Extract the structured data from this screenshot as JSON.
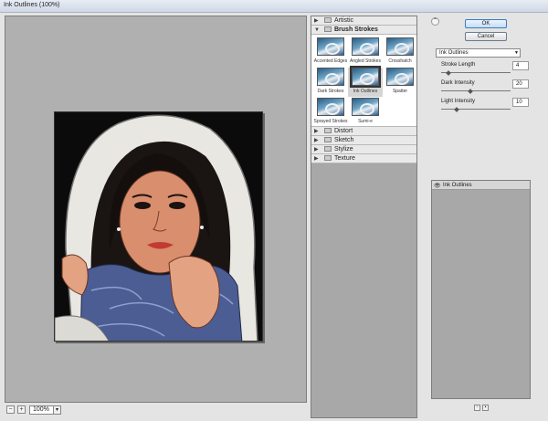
{
  "window": {
    "title": "Ink Outlines (100%)"
  },
  "preview": {
    "zoom_value": "100%"
  },
  "gallery": {
    "categories_top": [
      {
        "label": "Artistic",
        "open": false
      }
    ],
    "open_category": "Brush Strokes",
    "filters": [
      {
        "label": "Accented Edges",
        "selected": false
      },
      {
        "label": "Angled Strokes",
        "selected": false
      },
      {
        "label": "Crosshatch",
        "selected": false
      },
      {
        "label": "Dark Strokes",
        "selected": false
      },
      {
        "label": "Ink Outlines",
        "selected": true
      },
      {
        "label": "Spatter",
        "selected": false
      },
      {
        "label": "Sprayed Strokes",
        "selected": false
      },
      {
        "label": "Sumi-e",
        "selected": false
      }
    ],
    "categories_bottom": [
      {
        "label": "Distort"
      },
      {
        "label": "Sketch"
      },
      {
        "label": "Stylize"
      },
      {
        "label": "Texture"
      }
    ]
  },
  "dialog": {
    "ok_label": "OK",
    "cancel_label": "Cancel",
    "filter_select": "Ink Outlines",
    "params": [
      {
        "label": "Stroke Length",
        "value": "4",
        "fraction": 0.08
      },
      {
        "label": "Dark Intensity",
        "value": "20",
        "fraction": 0.4
      },
      {
        "label": "Light Intensity",
        "value": "10",
        "fraction": 0.2
      }
    ]
  },
  "layers": {
    "items": [
      {
        "label": "Ink Outlines"
      }
    ]
  }
}
